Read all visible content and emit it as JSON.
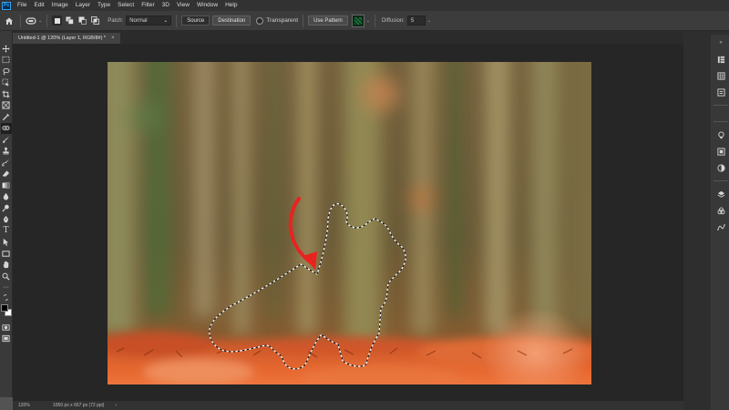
{
  "app": {
    "logo": "Ps",
    "menu": [
      "File",
      "Edit",
      "Image",
      "Layer",
      "Type",
      "Select",
      "Filter",
      "3D",
      "View",
      "Window",
      "Help"
    ]
  },
  "options": {
    "patch_label": "Patch:",
    "patch_mode": "Normal",
    "source_label": "Source",
    "destination_label": "Destination",
    "transparent_label": "Transparent",
    "use_pattern_label": "Use Pattern",
    "diffusion_label": "Diffusion:",
    "diffusion_value": "5"
  },
  "document": {
    "tab_title": "Untitled-1 @ 120% (Layer 1, RGB/8#) *",
    "close": "×"
  },
  "status": {
    "zoom": "120%",
    "info": "1050 px x 667 px (72 ppi)",
    "arrow": "›"
  },
  "colors": {
    "foreground": "#000000",
    "background": "#ffffff",
    "annotation_arrow": "#e8231f"
  }
}
